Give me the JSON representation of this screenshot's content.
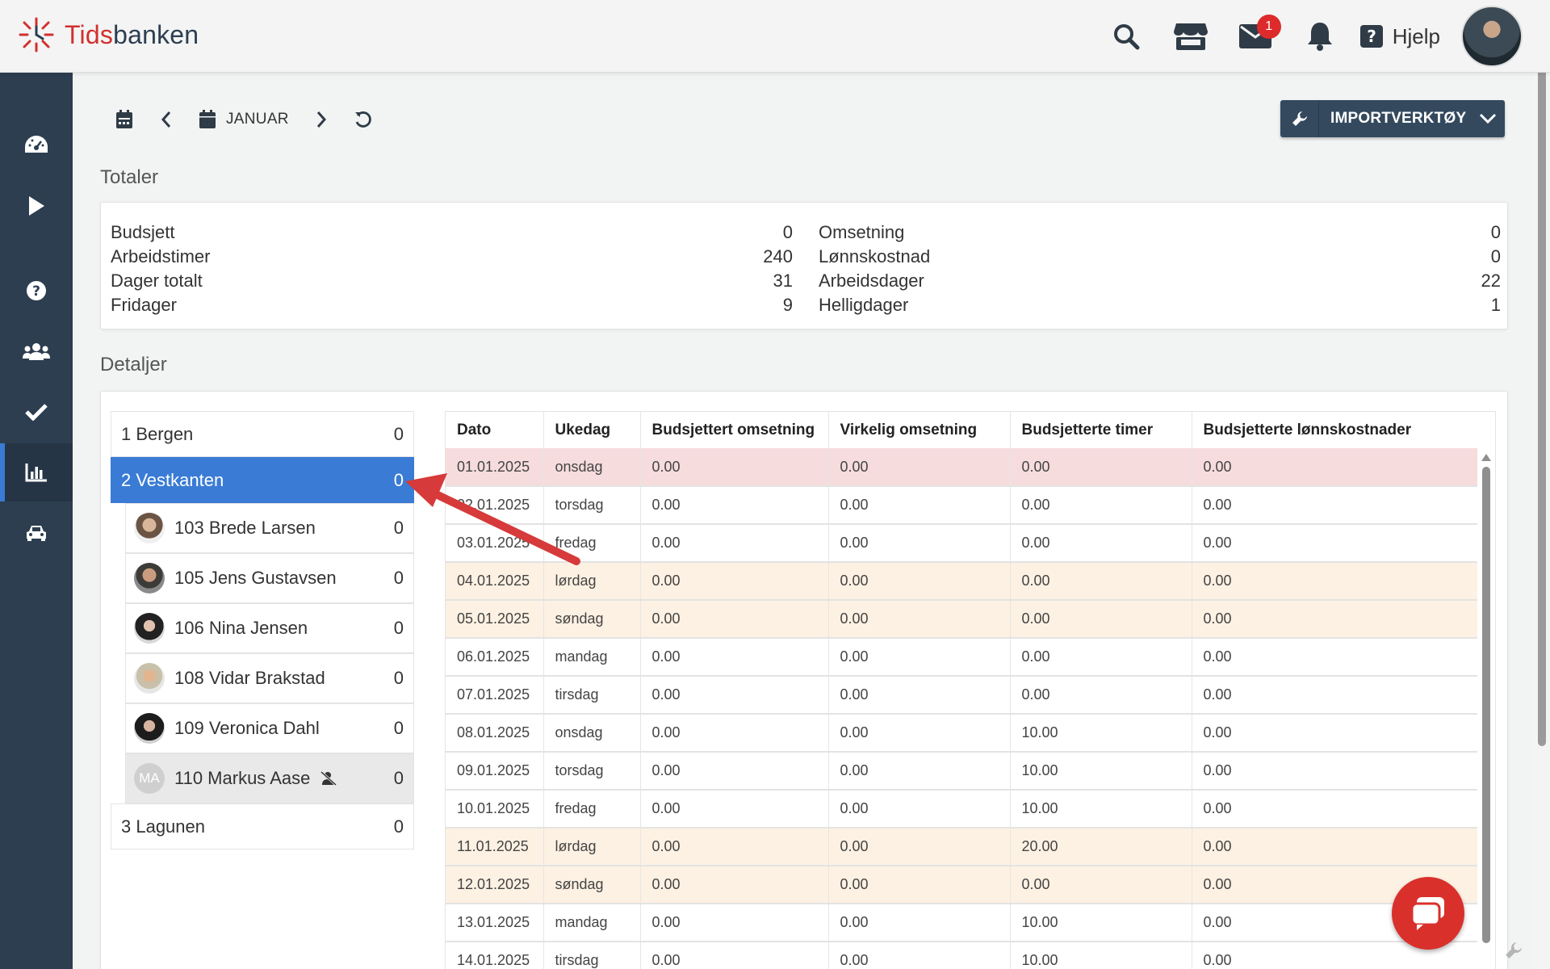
{
  "app": {
    "logo_red": "Tids",
    "logo_dark": "banken",
    "colors": {
      "sidebar": "#2c3e50",
      "accent": "#3a7bd5",
      "brand_red": "#d32f2f"
    }
  },
  "header": {
    "icons": [
      "search-icon",
      "store-icon",
      "mail-icon",
      "bell-icon",
      "help-icon"
    ],
    "mail_badge": "1",
    "help_label": "Hjelp"
  },
  "sidebar": {
    "items": [
      "dashboard-icon",
      "play-icon",
      "help-icon",
      "users-icon",
      "check-icon",
      "chart-icon",
      "car-icon"
    ],
    "active": "chart-icon"
  },
  "toolbar": {
    "month_label": "JANUAR",
    "import_label": "IMPORTVERKTØY"
  },
  "totals": {
    "title": "Totaler",
    "left": [
      {
        "label": "Budsjett",
        "value": "0"
      },
      {
        "label": "Arbeidstimer",
        "value": "240"
      },
      {
        "label": "Dager totalt",
        "value": "31"
      },
      {
        "label": "Fridager",
        "value": "9"
      }
    ],
    "right": [
      {
        "label": "Omsetning",
        "value": "0"
      },
      {
        "label": "Lønnskostnad",
        "value": "0"
      },
      {
        "label": "Arbeidsdager",
        "value": "22"
      },
      {
        "label": "Helligdager",
        "value": "1"
      }
    ]
  },
  "details": {
    "title": "Detaljer",
    "departments": [
      {
        "label": "1 Bergen",
        "value": "0"
      },
      {
        "label": "2 Vestkanten",
        "value": "0",
        "selected": true
      },
      {
        "label": "3 Lagunen",
        "value": "0"
      }
    ],
    "employees": [
      {
        "label": "103 Brede Larsen",
        "value": "0"
      },
      {
        "label": "105 Jens Gustavsen",
        "value": "0"
      },
      {
        "label": "106 Nina Jensen",
        "value": "0"
      },
      {
        "label": "108 Vidar Brakstad",
        "value": "0"
      },
      {
        "label": "109 Veronica Dahl",
        "value": "0"
      },
      {
        "label": "110 Markus Aase",
        "value": "0",
        "initials": "MA"
      }
    ],
    "table": {
      "headers": [
        "Dato",
        "Ukedag",
        "Budsjettert omsetning",
        "Virkelig omsetning",
        "Budsjetterte timer",
        "Budsjetterte lønnskostnader"
      ],
      "rows": [
        {
          "type": "holiday",
          "cells": [
            "01.01.2025",
            "onsdag",
            "0.00",
            "0.00",
            "0.00",
            "0.00"
          ]
        },
        {
          "type": "normal",
          "cells": [
            "02.01.2025",
            "torsdag",
            "0.00",
            "0.00",
            "0.00",
            "0.00"
          ]
        },
        {
          "type": "normal",
          "cells": [
            "03.01.2025",
            "fredag",
            "0.00",
            "0.00",
            "0.00",
            "0.00"
          ]
        },
        {
          "type": "weekend",
          "cells": [
            "04.01.2025",
            "lørdag",
            "0.00",
            "0.00",
            "0.00",
            "0.00"
          ]
        },
        {
          "type": "weekend",
          "cells": [
            "05.01.2025",
            "søndag",
            "0.00",
            "0.00",
            "0.00",
            "0.00"
          ]
        },
        {
          "type": "normal",
          "cells": [
            "06.01.2025",
            "mandag",
            "0.00",
            "0.00",
            "0.00",
            "0.00"
          ]
        },
        {
          "type": "normal",
          "cells": [
            "07.01.2025",
            "tirsdag",
            "0.00",
            "0.00",
            "0.00",
            "0.00"
          ]
        },
        {
          "type": "normal",
          "cells": [
            "08.01.2025",
            "onsdag",
            "0.00",
            "0.00",
            "10.00",
            "0.00"
          ]
        },
        {
          "type": "normal",
          "cells": [
            "09.01.2025",
            "torsdag",
            "0.00",
            "0.00",
            "10.00",
            "0.00"
          ]
        },
        {
          "type": "normal",
          "cells": [
            "10.01.2025",
            "fredag",
            "0.00",
            "0.00",
            "10.00",
            "0.00"
          ]
        },
        {
          "type": "weekend",
          "cells": [
            "11.01.2025",
            "lørdag",
            "0.00",
            "0.00",
            "20.00",
            "0.00"
          ]
        },
        {
          "type": "weekend",
          "cells": [
            "12.01.2025",
            "søndag",
            "0.00",
            "0.00",
            "0.00",
            "0.00"
          ]
        },
        {
          "type": "normal",
          "cells": [
            "13.01.2025",
            "mandag",
            "0.00",
            "0.00",
            "10.00",
            "0.00"
          ]
        },
        {
          "type": "normal",
          "cells": [
            "14.01.2025",
            "tirsdag",
            "0.00",
            "0.00",
            "10.00",
            "0.00"
          ]
        }
      ]
    }
  }
}
